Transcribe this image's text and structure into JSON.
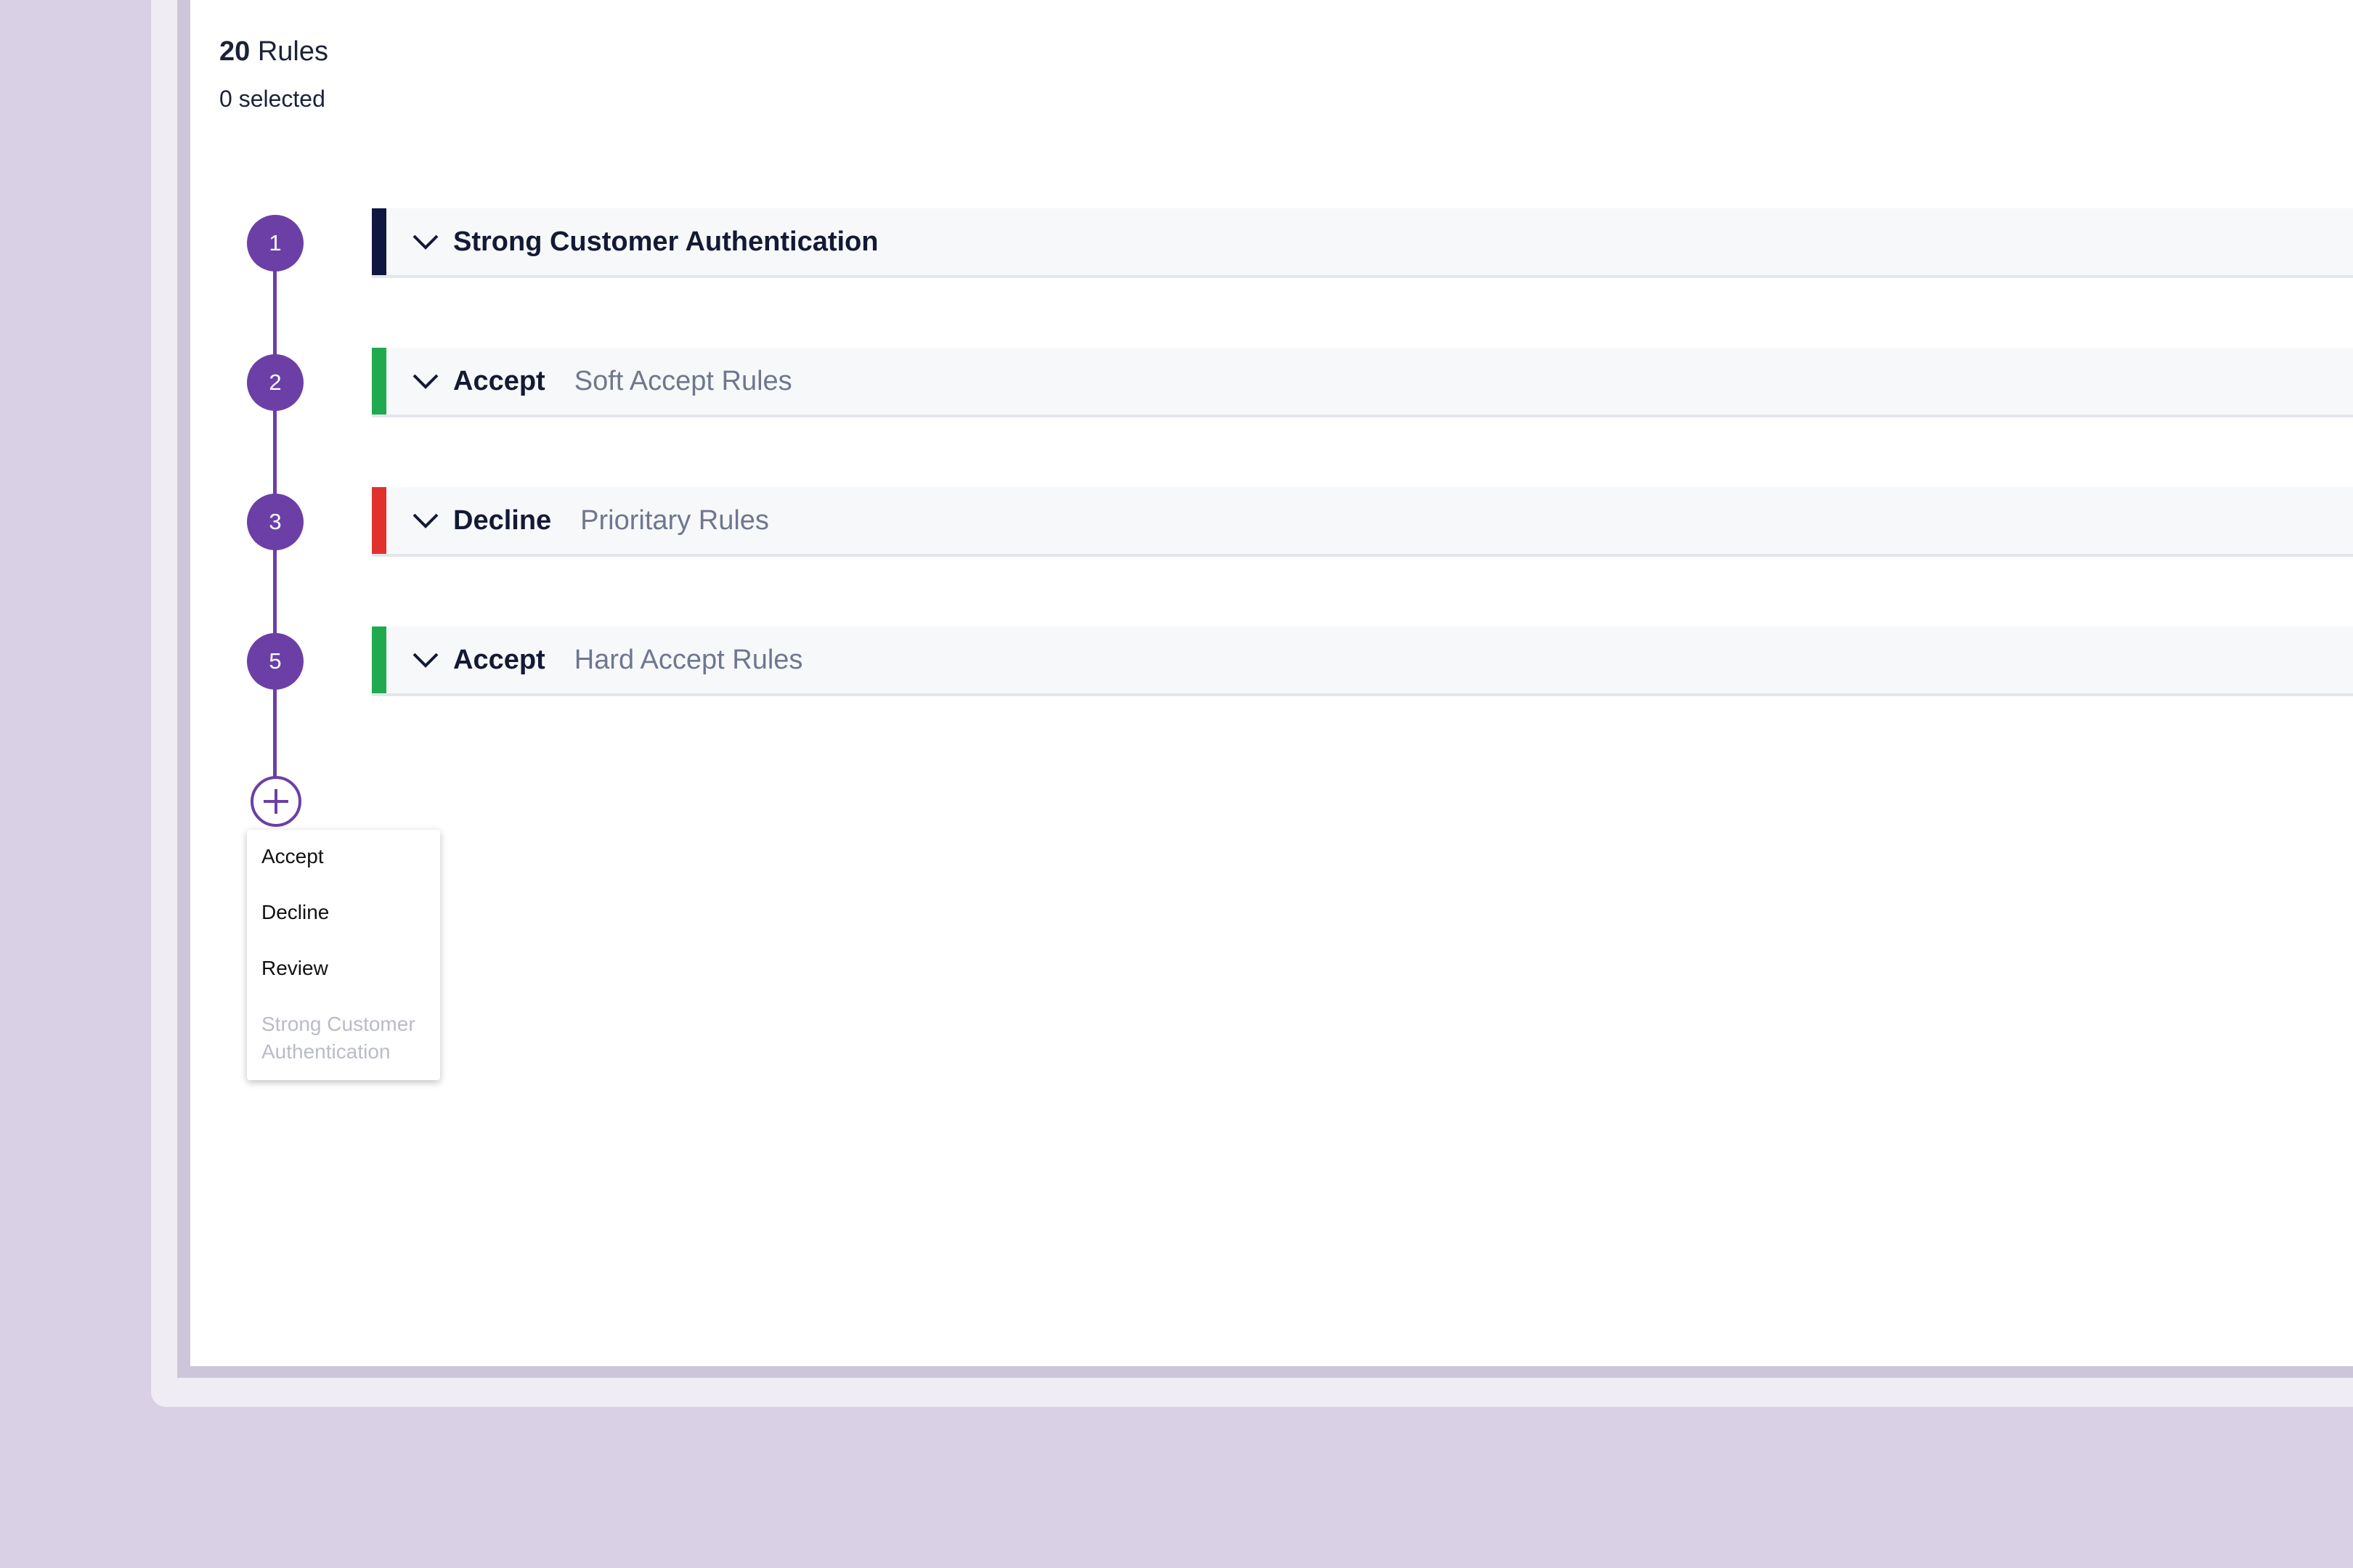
{
  "summary": {
    "rules_count": "20",
    "rules_label": "Rules",
    "selected_text": "0 selected"
  },
  "rules": [
    {
      "step": "1",
      "title": "Strong Customer Authentication",
      "subtitle": "",
      "bar_color": "#0f1640"
    },
    {
      "step": "2",
      "title": "Accept",
      "subtitle": "Soft Accept Rules",
      "bar_color": "#1faa4f"
    },
    {
      "step": "3",
      "title": "Decline",
      "subtitle": "Prioritary Rules",
      "bar_color": "#e0322d"
    },
    {
      "step": "5",
      "title": "Accept",
      "subtitle": "Hard Accept Rules",
      "bar_color": "#1faa4f"
    }
  ],
  "add_menu": {
    "items": [
      "Accept",
      "Decline",
      "Review"
    ],
    "disabled_item": "Strong Customer Authentication"
  },
  "icons": {
    "row_toggle": "chevron-down-icon",
    "add": "plus-icon"
  },
  "colors": {
    "accent": "#6c3fa6",
    "background": "#d9d0e5"
  }
}
